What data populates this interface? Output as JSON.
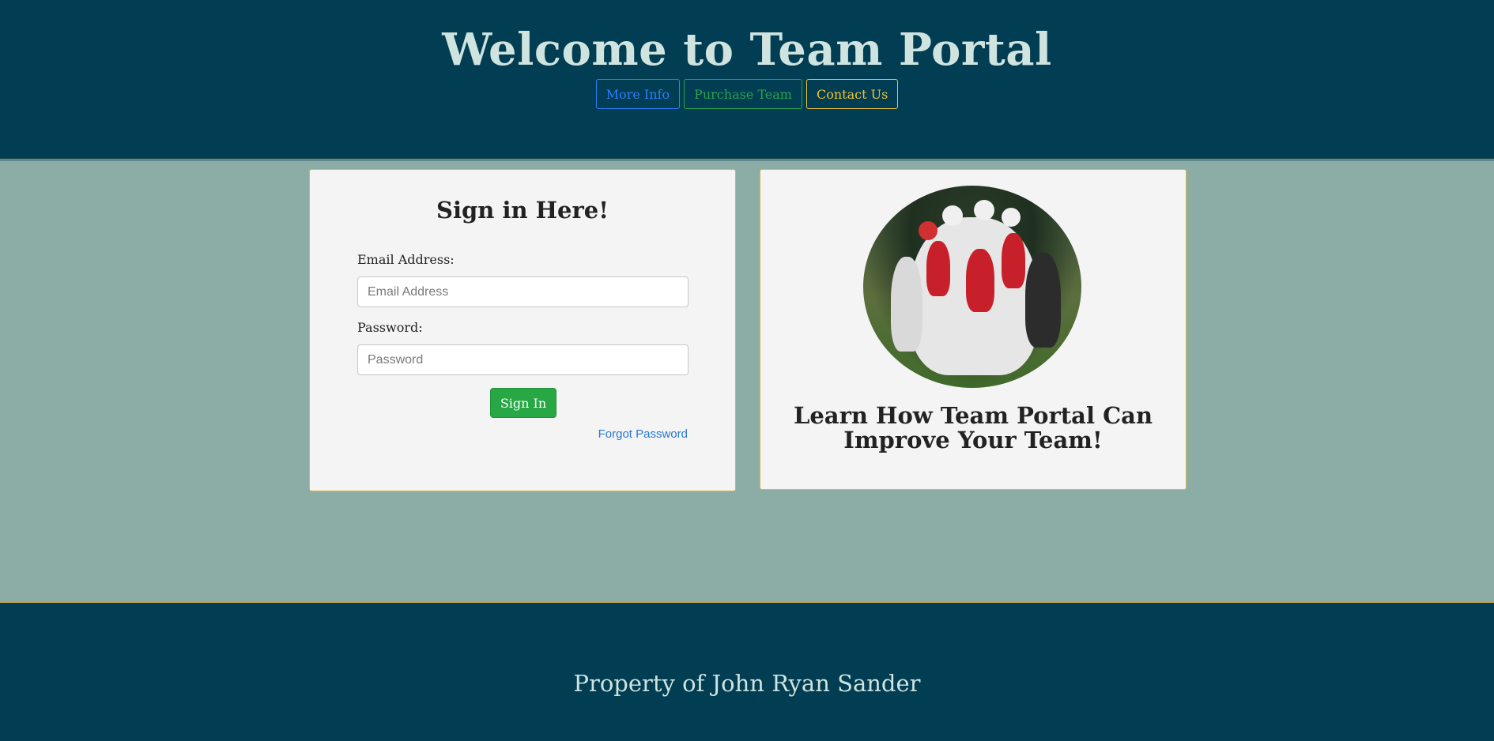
{
  "header": {
    "title": "Welcome to Team Portal",
    "nav": {
      "more_info": "More Info",
      "purchase_team": "Purchase Team",
      "contact_us": "Contact Us"
    }
  },
  "signin": {
    "title": "Sign in Here!",
    "email_label": "Email Address:",
    "email_placeholder": "Email Address",
    "email_value": "",
    "password_label": "Password:",
    "password_placeholder": "Password",
    "password_value": "",
    "submit_label": "Sign In",
    "forgot_label": "Forgot Password"
  },
  "promo": {
    "image_icon": "team-photo",
    "text": "Learn How Team Portal Can Improve Your Team!"
  },
  "footer": {
    "text": "Property of John Ryan Sander"
  },
  "colors": {
    "header_bg": "#013d53",
    "main_bg": "#8cada6",
    "card_bg": "#f4f4f4",
    "accent_border": "#d8b54b",
    "title_text": "#cfe3df",
    "info": "#2b7fff",
    "success": "#28a745",
    "warning": "#f2c230",
    "link": "#2a78d6"
  }
}
